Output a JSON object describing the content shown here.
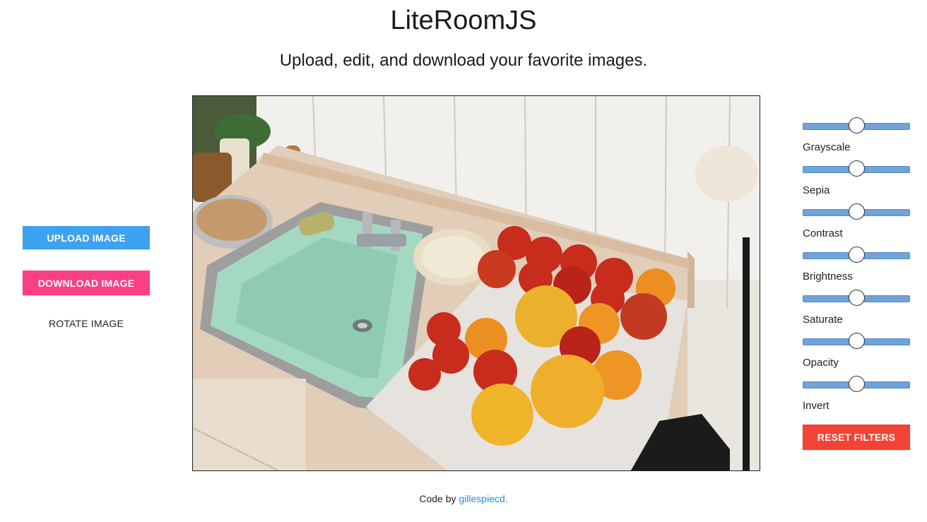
{
  "header": {
    "title": "LiteRoomJS",
    "subtitle": "Upload, edit, and download your favorite images."
  },
  "actions": {
    "upload_label": "UPLOAD IMAGE",
    "download_label": "DOWNLOAD IMAGE",
    "rotate_label": "ROTATE IMAGE"
  },
  "image": {
    "alt": "Photo of a mint green kitchen sink with tomatoes on a cutting board"
  },
  "filters": [
    {
      "label": "Grayscale",
      "value": 0.5
    },
    {
      "label": "Sepia",
      "value": 0.5
    },
    {
      "label": "Contrast",
      "value": 0.5
    },
    {
      "label": "Brightness",
      "value": 0.5
    },
    {
      "label": "Saturate",
      "value": 0.5
    },
    {
      "label": "Opacity",
      "value": 0.5
    },
    {
      "label": "Invert",
      "value": 0.5
    }
  ],
  "reset_label": "RESET FILTERS",
  "footer": {
    "prefix": "Code by",
    "author": "gillespiecd."
  },
  "colors": {
    "upload": "#3ea2ef",
    "download": "#fb3f85",
    "reset": "#f34336",
    "slider_track": "#6fa3d9",
    "link": "#2a8be3"
  }
}
